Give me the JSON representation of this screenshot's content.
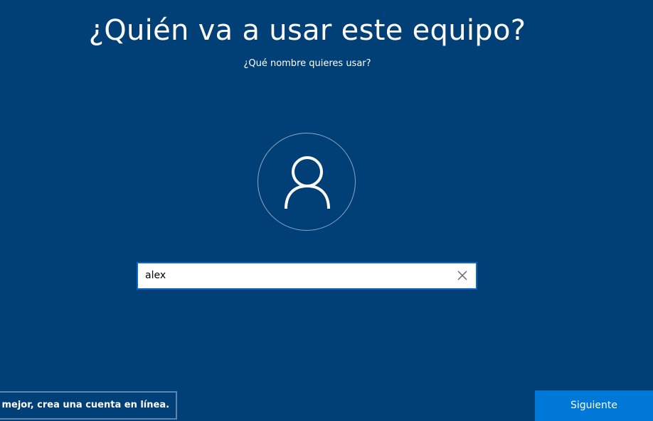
{
  "header": {
    "title": "¿Quién va a usar este equipo?",
    "subtitle": "¿Qué nombre quieres usar?"
  },
  "avatar": {
    "icon": "user-icon"
  },
  "name_field": {
    "value": "alex",
    "clear_icon": "close-icon"
  },
  "footer": {
    "online_account_label": "uso mejor, crea una cuenta en línea.",
    "next_label": "Siguiente"
  },
  "colors": {
    "background": "#013f77",
    "accent": "#0078d7",
    "input_border": "#0a67c6"
  }
}
